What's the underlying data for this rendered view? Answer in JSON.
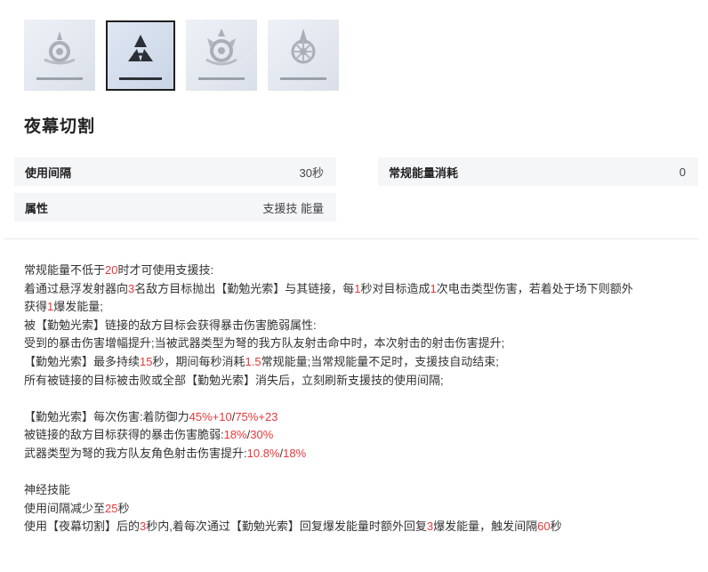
{
  "skill_icons": [
    {
      "name": "skill-icon-1",
      "selected": false
    },
    {
      "name": "skill-icon-2",
      "selected": true
    },
    {
      "name": "skill-icon-3",
      "selected": false
    },
    {
      "name": "skill-icon-4",
      "selected": false
    }
  ],
  "title": "夜幕切割",
  "stats": [
    {
      "key": "使用间隔",
      "value": "30秒"
    },
    {
      "key": "常规能量消耗",
      "value": "0"
    },
    {
      "key": "属性",
      "value": "支援技 能量"
    }
  ],
  "colors": {
    "highlight": "#e5383b",
    "text": "#333333",
    "stat_bg": "#f5f6f8"
  },
  "description": [
    [
      {
        "t": "常规能量不低于"
      },
      {
        "t": "20",
        "h": true
      },
      {
        "t": "时才可使用支援技:"
      }
    ],
    [
      {
        "t": "着通过悬浮发射器向"
      },
      {
        "t": "3",
        "h": true
      },
      {
        "t": "名敌方目标抛出【勤勉光索】与其链接，每"
      },
      {
        "t": "1",
        "h": true
      },
      {
        "t": "秒对目标造成"
      },
      {
        "t": "1",
        "h": true
      },
      {
        "t": "次电击类型伤害，若着处于场下则额外"
      }
    ],
    [
      {
        "t": "获得"
      },
      {
        "t": "1",
        "h": true
      },
      {
        "t": "爆发能量;"
      }
    ],
    [
      {
        "t": "被【勤勉光索】链接的敌方目标会获得暴击伤害脆弱属性:"
      }
    ],
    [
      {
        "t": "受到的暴击伤害增幅提升;当被武器类型为弩的我方队友射击命中时，本次射击的射击伤害提升;"
      }
    ],
    [
      {
        "t": "【勤勉光索】最多持续"
      },
      {
        "t": "15",
        "h": true
      },
      {
        "t": "秒，期间每秒消耗"
      },
      {
        "t": "1.5",
        "h": true
      },
      {
        "t": "常规能量;当常规能量不足时，支援技自动结束;"
      }
    ],
    [
      {
        "t": "所有被链接的目标被击败或全部【勤勉光索】消失后，立刻刷新支援技的使用间隔;"
      }
    ],
    [],
    [
      {
        "t": "【勤勉光索】每次伤害:着防御力"
      },
      {
        "t": "45%+10",
        "h": true
      },
      {
        "t": "/"
      },
      {
        "t": "75%+23",
        "h": true
      }
    ],
    [
      {
        "t": "被链接的敌方目标获得的暴击伤害脆弱:"
      },
      {
        "t": "18%",
        "h": true
      },
      {
        "t": "/"
      },
      {
        "t": "30%",
        "h": true
      }
    ],
    [
      {
        "t": "武器类型为弩的我方队友角色射击伤害提升:"
      },
      {
        "t": "10.8%",
        "h": true
      },
      {
        "t": "/"
      },
      {
        "t": "18%",
        "h": true
      }
    ],
    [],
    [
      {
        "t": "神经技能"
      }
    ],
    [
      {
        "t": "使用间隔减少至"
      },
      {
        "t": "25",
        "h": true
      },
      {
        "t": "秒"
      }
    ],
    [
      {
        "t": "使用【夜幕切割】后的"
      },
      {
        "t": "3",
        "h": true
      },
      {
        "t": "秒内,着每次通过【勤勉光索】回复爆发能量时额外回复"
      },
      {
        "t": "3",
        "h": true
      },
      {
        "t": "爆发能量，触发间隔"
      },
      {
        "t": "60",
        "h": true
      },
      {
        "t": "秒"
      }
    ]
  ]
}
